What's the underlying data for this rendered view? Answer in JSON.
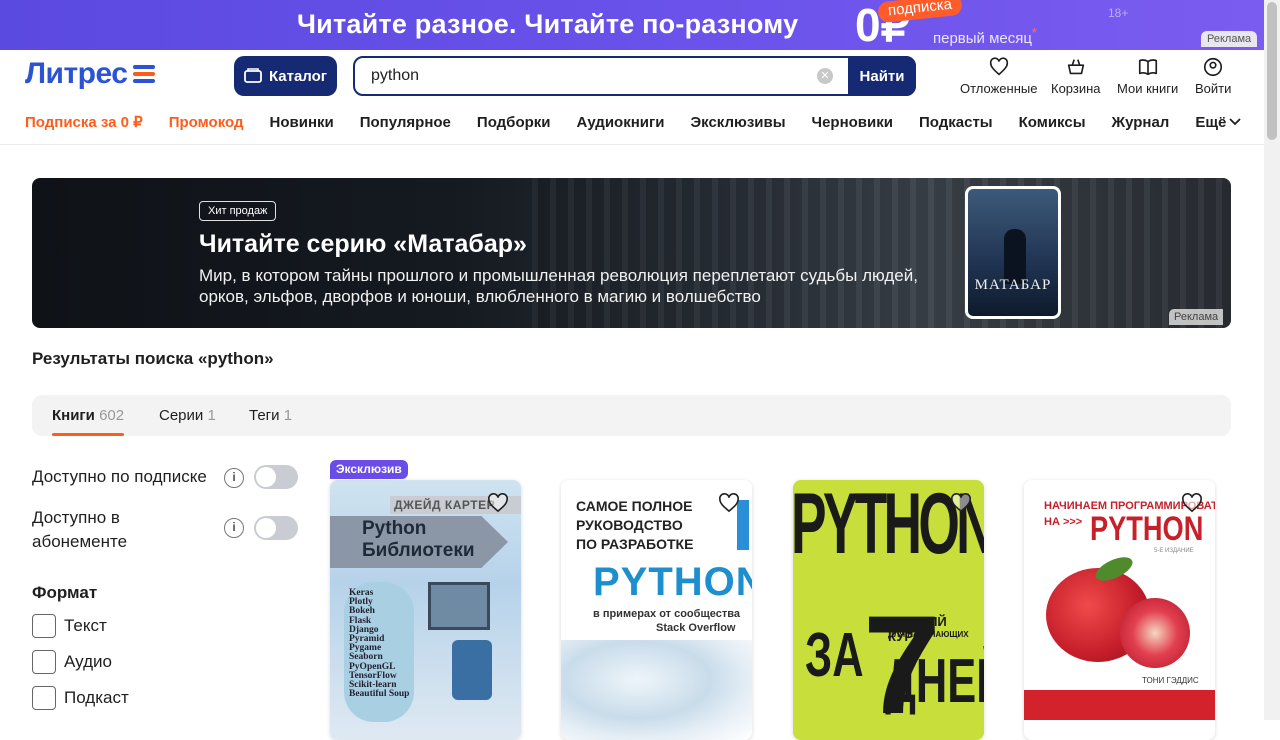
{
  "promo": {
    "text": "Читайте разное. Читайте по-разному",
    "price": "0₽",
    "badge": "подписка",
    "sub": "первый месяц",
    "age": "18+",
    "ad": "Реклама"
  },
  "header": {
    "logo": "Литрес",
    "catalog": "Каталог",
    "search_value": "python",
    "search_button": "Найти",
    "nav": [
      "Отложенные",
      "Корзина",
      "Мои книги",
      "Войти"
    ]
  },
  "menu": {
    "items": [
      "Подписка за 0 ₽",
      "Промокод",
      "Новинки",
      "Популярное",
      "Подборки",
      "Аудиокниги",
      "Эксклюзивы",
      "Черновики",
      "Подкасты",
      "Комиксы",
      "Журнал",
      "Ещё"
    ]
  },
  "banner": {
    "tag": "Хит продаж",
    "title": "Читайте серию «Матабар»",
    "desc": "Мир, в котором тайны прошлого и промышленная революция переплетают судьбы людей, орков, эльфов, дворфов и юноши, влюбленного в магию и волшебство",
    "book_title": "МАТАБАР",
    "ad": "Реклама"
  },
  "results": {
    "title": "Результаты поиска «python»"
  },
  "tabs": [
    {
      "label": "Книги",
      "count": "602"
    },
    {
      "label": "Серии",
      "count": "1"
    },
    {
      "label": "Теги",
      "count": "1"
    }
  ],
  "filters": {
    "subscription": "Доступно по подписке",
    "abonement": "Доступно в абонементе",
    "format_title": "Формат",
    "formats": [
      "Текст",
      "Аудио",
      "Подкаст"
    ]
  },
  "cards": [
    {
      "badge": "Эксклюзив",
      "author": "ДЖЕЙД КАРТЕР",
      "title1": "Python",
      "title2": "Библиотеки",
      "libs": [
        "Keras",
        "Plotly",
        "Bokeh",
        "Flask",
        "Django",
        "Pyramid",
        "Pygame",
        "Seaborn",
        "PyOpenGL",
        "TensorFlow",
        "Scikit-learn",
        "Beautiful Soup"
      ]
    },
    {
      "line1": "САМОЕ ПОЛНОЕ",
      "line2": "РУКОВОДСТВО",
      "line3": "ПО РАЗРАБОТКЕ",
      "big": "PYTHON",
      "sub1": "в примерах от сообщества",
      "sub2": "Stack Overflow"
    },
    {
      "big": "PYTHON",
      "za": "ЗА",
      "num": "7",
      "small1": "КРАТКИЙ КУРС",
      "small2": "ДЛЯ НАЧИНАЮЩИХ",
      "dney": "ДНЕЙ"
    },
    {
      "line1": "НАЧИНАЕМ ПРОГРАММИРОВАТЬ",
      "line2": "НА >>>",
      "big": "PYTHON",
      "edition": "5-Е ИЗДАНИЕ",
      "author": "ТОНИ ГЭДДИС"
    }
  ],
  "colors": {
    "brand": "#2b53d4",
    "navy": "#152a73",
    "orange": "#ff5c1b",
    "promo": "#6a52ea"
  }
}
